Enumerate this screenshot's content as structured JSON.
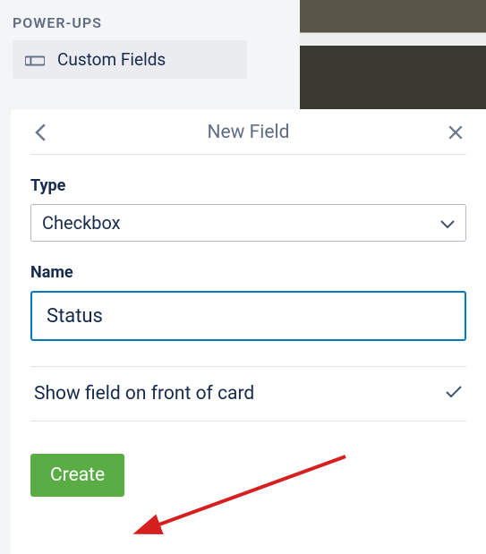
{
  "section": {
    "header": "POWER-UPS",
    "powerup_label": "Custom Fields"
  },
  "popover": {
    "title": "New Field",
    "type_label": "Type",
    "type_value": "Checkbox",
    "name_label": "Name",
    "name_value": "Status",
    "show_front_label": "Show field on front of card",
    "create_label": "Create"
  }
}
